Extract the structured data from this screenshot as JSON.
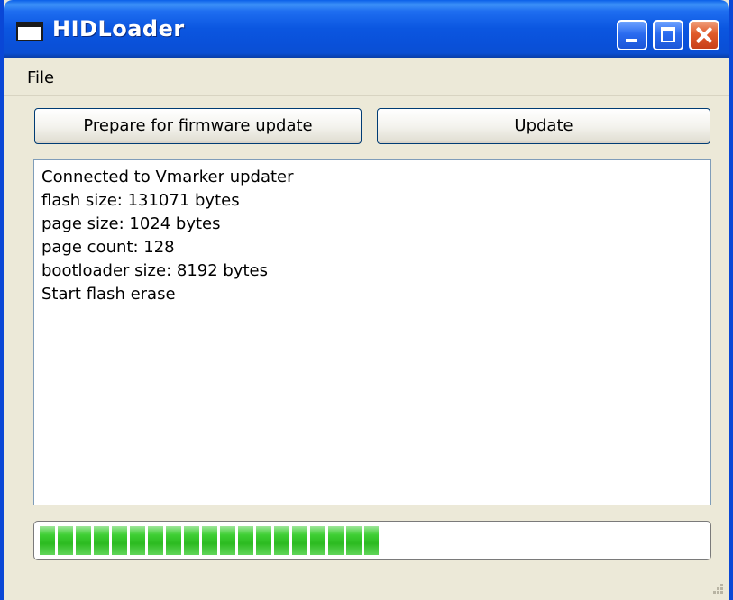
{
  "window": {
    "title": "HIDLoader"
  },
  "menu": {
    "items": [
      "File"
    ]
  },
  "buttons": {
    "prepare": "Prepare for firmware update",
    "update": "Update"
  },
  "log": {
    "lines": [
      "Connected to Vmarker updater",
      "flash size: 131071 bytes",
      "page size: 1024 bytes",
      "page count: 128",
      "bootloader size: 8192 bytes",
      "Start flash erase"
    ]
  },
  "progress": {
    "value_percent": 51
  },
  "colors": {
    "titlebar": "#0a50d8",
    "progress_fill": "#3fcf34",
    "close_button": "#e05a2a"
  }
}
